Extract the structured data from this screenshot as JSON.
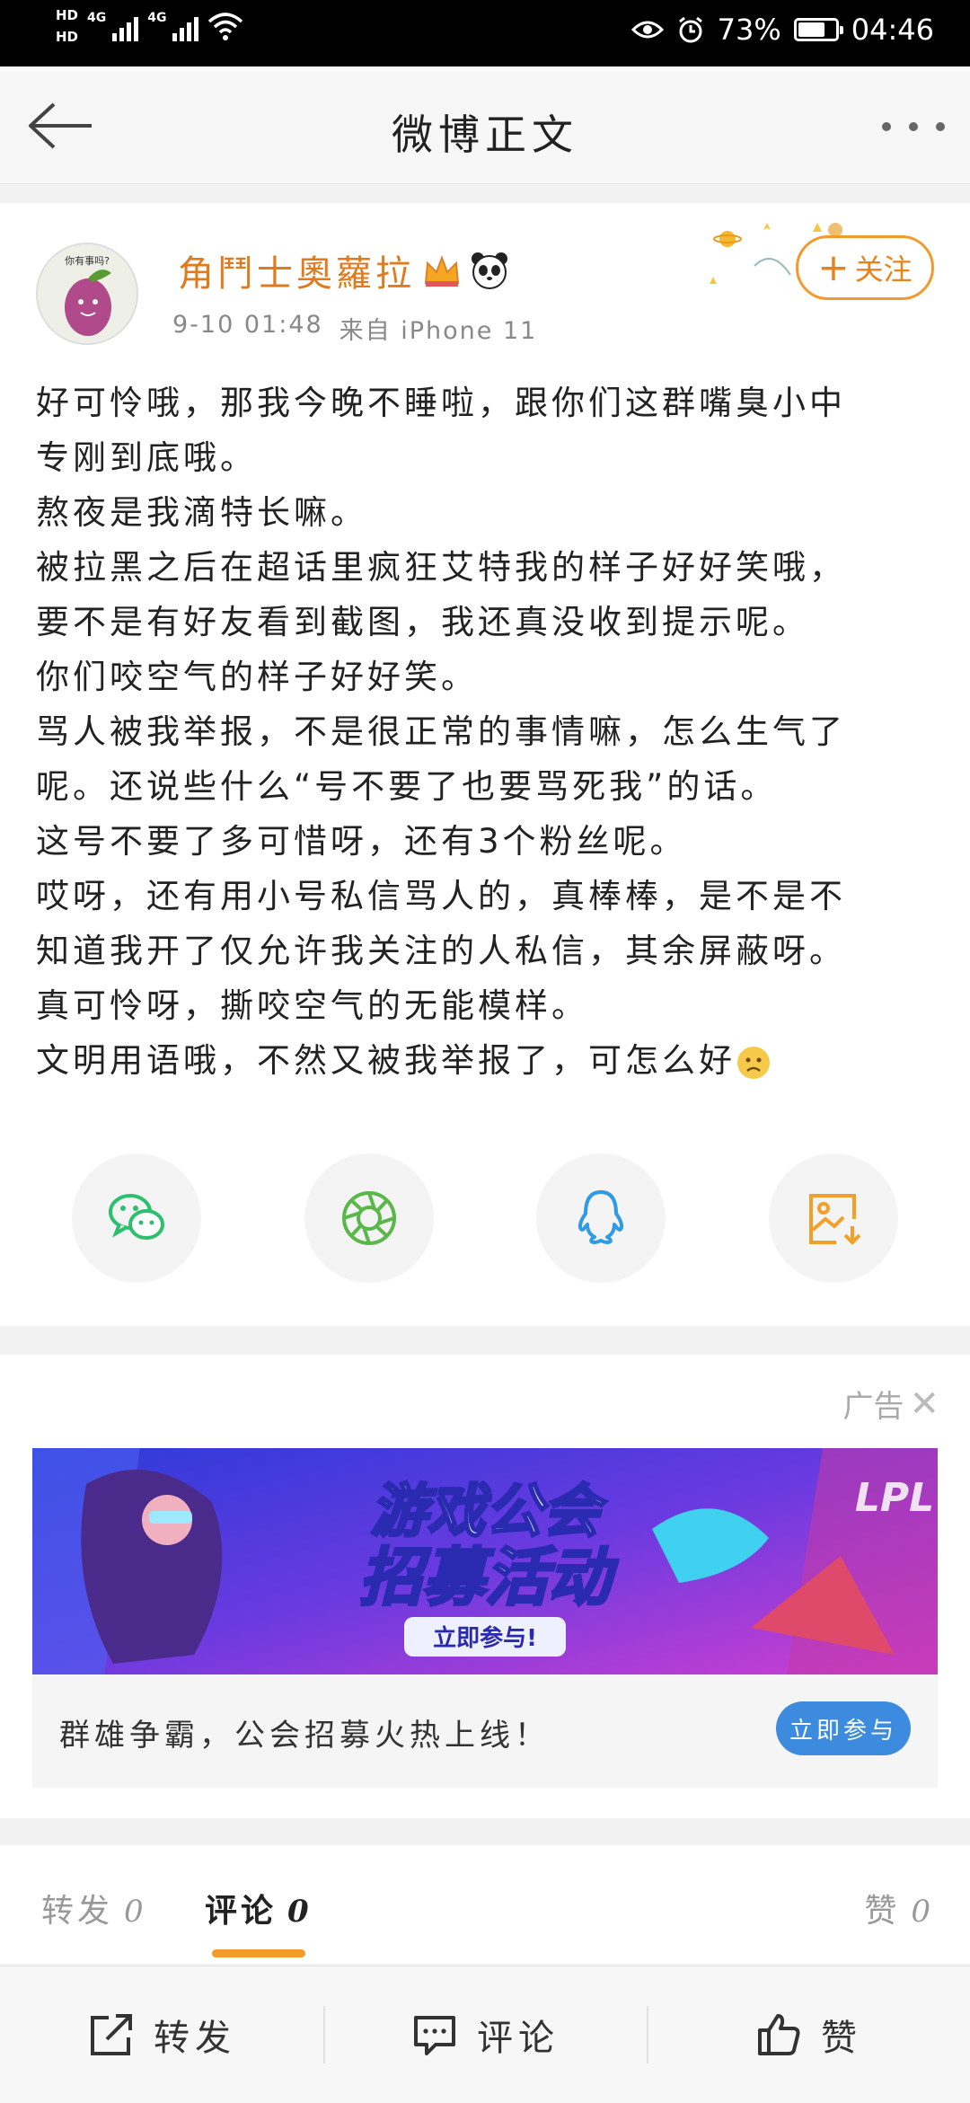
{
  "status_bar": {
    "hd1": "HD",
    "hd2": "HD",
    "net1": "4G",
    "net2": "4G",
    "battery_percent": "73%",
    "battery_level": 0.73,
    "time": "04:46"
  },
  "navbar": {
    "title": "微博正文"
  },
  "post": {
    "username": "角鬥士奧蘿拉",
    "avatar_caption": "你有事吗?",
    "date": "9-10 01:48",
    "source": "来自 iPhone 11",
    "follow_label": "关注",
    "lines": [
      "好可怜哦，那我今晚不睡啦，跟你们这群嘴臭小中",
      "专刚到底哦。",
      "熬夜是我滴特长嘛。",
      "被拉黑之后在超话里疯狂艾特我的样子好好笑哦，",
      "要不是有好友看到截图，我还真没收到提示呢。",
      "你们咬空气的样子好好笑。",
      "骂人被我举报，不是很正常的事情嘛，怎么生气了",
      "呢。还说些什么“号不要了也要骂死我”的话。",
      "这号不要了多可惜呀，还有3个粉丝呢。",
      "哎呀，还有用小号私信骂人的，真棒棒，是不是不",
      "知道我开了仅允许我关注的人私信，其余屏蔽呀。",
      "真可怜呀，撕咬空气的无能模样。",
      "文明用语哦，不然又被我举报了，可怎么好"
    ],
    "share_icons": [
      "wechat-icon",
      "moments-icon",
      "qq-icon",
      "save-image-icon"
    ]
  },
  "ad": {
    "label": "广告",
    "close": "✕",
    "banner_title_1": "游戏公会",
    "banner_title_2": "招募活动",
    "banner_cta": "立即参与!",
    "banner_corner": "LPL",
    "text": "群雄争霸，公会招募火热上线！",
    "button": "立即参与"
  },
  "tabs": [
    {
      "label": "转发",
      "count": "0"
    },
    {
      "label": "评论",
      "count": "0"
    },
    {
      "label": "赞",
      "count": "0"
    }
  ],
  "toolbar": {
    "repost": "转发",
    "comment": "评论",
    "like": "赞"
  },
  "colors": {
    "accent_orange": "#f39a2c",
    "username_orange": "#e07a1c",
    "ad_button_blue": "#3d8bdf",
    "wechat_green": "#2cbf6e",
    "moments_green": "#5ab84a",
    "qq_blue": "#2f9be6",
    "save_orange": "#f2a02a"
  }
}
